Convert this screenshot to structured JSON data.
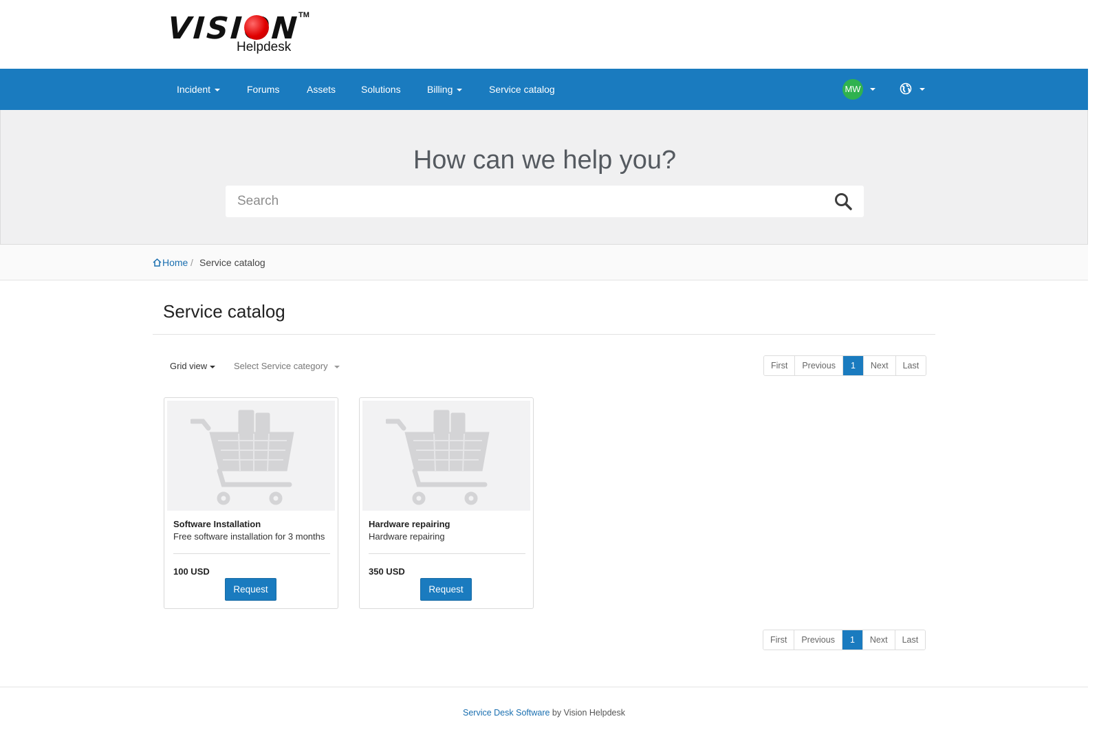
{
  "brand": {
    "logo_text": "VISION",
    "logo_sub": "Helpdesk",
    "trademark": "TM"
  },
  "nav": {
    "items": [
      {
        "label": "Incident",
        "dropdown": true
      },
      {
        "label": "Forums",
        "dropdown": false
      },
      {
        "label": "Assets",
        "dropdown": false
      },
      {
        "label": "Solutions",
        "dropdown": false
      },
      {
        "label": "Billing",
        "dropdown": true
      },
      {
        "label": "Service catalog",
        "dropdown": false
      }
    ],
    "user_initials": "MW",
    "accent_color": "#1a7bbf",
    "avatar_color": "#2fb24f"
  },
  "hero": {
    "title": "How can we help you?",
    "search_placeholder": "Search",
    "search_value": ""
  },
  "breadcrumb": {
    "home": "Home",
    "separator": "/",
    "current": "Service catalog"
  },
  "main": {
    "title": "Service catalog",
    "view_toggle": "Grid view",
    "category_select": "Select Service category",
    "pagination": {
      "first": "First",
      "previous": "Previous",
      "current": "1",
      "next": "Next",
      "last": "Last"
    },
    "cards": [
      {
        "title": "Software Installation",
        "description": "Free software installation for 3 months",
        "price": "100 USD",
        "button": "Request",
        "image_icon": "shopping-cart-icon"
      },
      {
        "title": "Hardware repairing",
        "description": "Hardware repairing",
        "price": "350 USD",
        "button": "Request",
        "image_icon": "shopping-cart-icon"
      }
    ]
  },
  "footer": {
    "link_text": "Service Desk Software",
    "suffix": " by Vision Helpdesk"
  }
}
